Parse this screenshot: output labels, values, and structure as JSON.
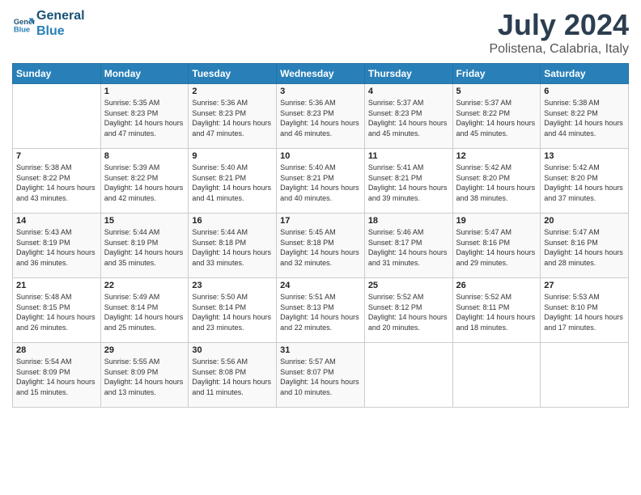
{
  "header": {
    "logo_line1": "General",
    "logo_line2": "Blue",
    "month": "July 2024",
    "location": "Polistena, Calabria, Italy"
  },
  "weekdays": [
    "Sunday",
    "Monday",
    "Tuesday",
    "Wednesday",
    "Thursday",
    "Friday",
    "Saturday"
  ],
  "weeks": [
    [
      {
        "day": "",
        "sunrise": "",
        "sunset": "",
        "daylight": ""
      },
      {
        "day": "1",
        "sunrise": "5:35 AM",
        "sunset": "8:23 PM",
        "daylight": "14 hours and 47 minutes."
      },
      {
        "day": "2",
        "sunrise": "5:36 AM",
        "sunset": "8:23 PM",
        "daylight": "14 hours and 47 minutes."
      },
      {
        "day": "3",
        "sunrise": "5:36 AM",
        "sunset": "8:23 PM",
        "daylight": "14 hours and 46 minutes."
      },
      {
        "day": "4",
        "sunrise": "5:37 AM",
        "sunset": "8:23 PM",
        "daylight": "14 hours and 45 minutes."
      },
      {
        "day": "5",
        "sunrise": "5:37 AM",
        "sunset": "8:22 PM",
        "daylight": "14 hours and 45 minutes."
      },
      {
        "day": "6",
        "sunrise": "5:38 AM",
        "sunset": "8:22 PM",
        "daylight": "14 hours and 44 minutes."
      }
    ],
    [
      {
        "day": "7",
        "sunrise": "5:38 AM",
        "sunset": "8:22 PM",
        "daylight": "14 hours and 43 minutes."
      },
      {
        "day": "8",
        "sunrise": "5:39 AM",
        "sunset": "8:22 PM",
        "daylight": "14 hours and 42 minutes."
      },
      {
        "day": "9",
        "sunrise": "5:40 AM",
        "sunset": "8:21 PM",
        "daylight": "14 hours and 41 minutes."
      },
      {
        "day": "10",
        "sunrise": "5:40 AM",
        "sunset": "8:21 PM",
        "daylight": "14 hours and 40 minutes."
      },
      {
        "day": "11",
        "sunrise": "5:41 AM",
        "sunset": "8:21 PM",
        "daylight": "14 hours and 39 minutes."
      },
      {
        "day": "12",
        "sunrise": "5:42 AM",
        "sunset": "8:20 PM",
        "daylight": "14 hours and 38 minutes."
      },
      {
        "day": "13",
        "sunrise": "5:42 AM",
        "sunset": "8:20 PM",
        "daylight": "14 hours and 37 minutes."
      }
    ],
    [
      {
        "day": "14",
        "sunrise": "5:43 AM",
        "sunset": "8:19 PM",
        "daylight": "14 hours and 36 minutes."
      },
      {
        "day": "15",
        "sunrise": "5:44 AM",
        "sunset": "8:19 PM",
        "daylight": "14 hours and 35 minutes."
      },
      {
        "day": "16",
        "sunrise": "5:44 AM",
        "sunset": "8:18 PM",
        "daylight": "14 hours and 33 minutes."
      },
      {
        "day": "17",
        "sunrise": "5:45 AM",
        "sunset": "8:18 PM",
        "daylight": "14 hours and 32 minutes."
      },
      {
        "day": "18",
        "sunrise": "5:46 AM",
        "sunset": "8:17 PM",
        "daylight": "14 hours and 31 minutes."
      },
      {
        "day": "19",
        "sunrise": "5:47 AM",
        "sunset": "8:16 PM",
        "daylight": "14 hours and 29 minutes."
      },
      {
        "day": "20",
        "sunrise": "5:47 AM",
        "sunset": "8:16 PM",
        "daylight": "14 hours and 28 minutes."
      }
    ],
    [
      {
        "day": "21",
        "sunrise": "5:48 AM",
        "sunset": "8:15 PM",
        "daylight": "14 hours and 26 minutes."
      },
      {
        "day": "22",
        "sunrise": "5:49 AM",
        "sunset": "8:14 PM",
        "daylight": "14 hours and 25 minutes."
      },
      {
        "day": "23",
        "sunrise": "5:50 AM",
        "sunset": "8:14 PM",
        "daylight": "14 hours and 23 minutes."
      },
      {
        "day": "24",
        "sunrise": "5:51 AM",
        "sunset": "8:13 PM",
        "daylight": "14 hours and 22 minutes."
      },
      {
        "day": "25",
        "sunrise": "5:52 AM",
        "sunset": "8:12 PM",
        "daylight": "14 hours and 20 minutes."
      },
      {
        "day": "26",
        "sunrise": "5:52 AM",
        "sunset": "8:11 PM",
        "daylight": "14 hours and 18 minutes."
      },
      {
        "day": "27",
        "sunrise": "5:53 AM",
        "sunset": "8:10 PM",
        "daylight": "14 hours and 17 minutes."
      }
    ],
    [
      {
        "day": "28",
        "sunrise": "5:54 AM",
        "sunset": "8:09 PM",
        "daylight": "14 hours and 15 minutes."
      },
      {
        "day": "29",
        "sunrise": "5:55 AM",
        "sunset": "8:09 PM",
        "daylight": "14 hours and 13 minutes."
      },
      {
        "day": "30",
        "sunrise": "5:56 AM",
        "sunset": "8:08 PM",
        "daylight": "14 hours and 11 minutes."
      },
      {
        "day": "31",
        "sunrise": "5:57 AM",
        "sunset": "8:07 PM",
        "daylight": "14 hours and 10 minutes."
      },
      {
        "day": "",
        "sunrise": "",
        "sunset": "",
        "daylight": ""
      },
      {
        "day": "",
        "sunrise": "",
        "sunset": "",
        "daylight": ""
      },
      {
        "day": "",
        "sunrise": "",
        "sunset": "",
        "daylight": ""
      }
    ]
  ]
}
